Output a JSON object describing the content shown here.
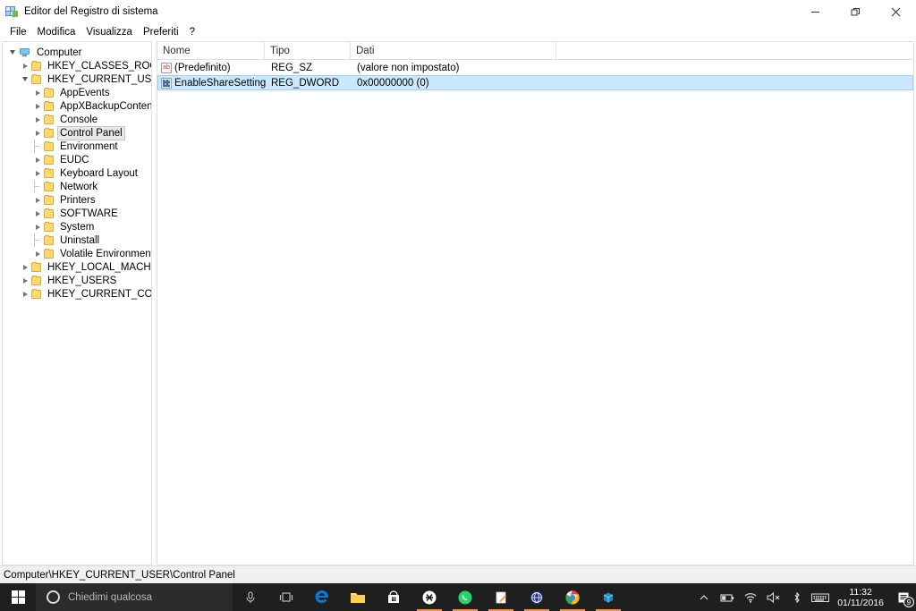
{
  "window": {
    "title": "Editor del Registro di sistema",
    "icon": "registry-editor-icon",
    "controls": {
      "minimize": "minimize-icon",
      "restore": "restore-icon",
      "close": "close-icon"
    }
  },
  "menubar": {
    "items": [
      {
        "label": "File"
      },
      {
        "label": "Modifica"
      },
      {
        "label": "Visualizza"
      },
      {
        "label": "Preferiti"
      },
      {
        "label": "?"
      }
    ]
  },
  "tree": {
    "items": [
      {
        "label": "Computer",
        "depth": 0,
        "state": "open",
        "icon": "computer-icon",
        "selected": false
      },
      {
        "label": "HKEY_CLASSES_ROOT",
        "depth": 1,
        "state": "collapsed",
        "icon": "folder-icon",
        "selected": false
      },
      {
        "label": "HKEY_CURRENT_USER",
        "depth": 1,
        "state": "open",
        "icon": "folder-icon",
        "selected": false
      },
      {
        "label": "AppEvents",
        "depth": 2,
        "state": "collapsed",
        "icon": "folder-icon",
        "selected": false
      },
      {
        "label": "AppXBackupContentType",
        "depth": 2,
        "state": "collapsed",
        "icon": "folder-icon",
        "selected": false
      },
      {
        "label": "Console",
        "depth": 2,
        "state": "collapsed",
        "icon": "folder-icon",
        "selected": false
      },
      {
        "label": "Control Panel",
        "depth": 2,
        "state": "collapsed",
        "icon": "folder-icon",
        "selected": true
      },
      {
        "label": "Environment",
        "depth": 2,
        "state": "leaf",
        "icon": "folder-icon",
        "selected": false
      },
      {
        "label": "EUDC",
        "depth": 2,
        "state": "collapsed",
        "icon": "folder-icon",
        "selected": false
      },
      {
        "label": "Keyboard Layout",
        "depth": 2,
        "state": "collapsed",
        "icon": "folder-icon",
        "selected": false
      },
      {
        "label": "Network",
        "depth": 2,
        "state": "leaf",
        "icon": "folder-icon",
        "selected": false
      },
      {
        "label": "Printers",
        "depth": 2,
        "state": "collapsed",
        "icon": "folder-icon",
        "selected": false
      },
      {
        "label": "SOFTWARE",
        "depth": 2,
        "state": "collapsed",
        "icon": "folder-icon",
        "selected": false
      },
      {
        "label": "System",
        "depth": 2,
        "state": "collapsed",
        "icon": "folder-icon",
        "selected": false
      },
      {
        "label": "Uninstall",
        "depth": 2,
        "state": "leaf",
        "icon": "folder-icon",
        "selected": false
      },
      {
        "label": "Volatile Environment",
        "depth": 2,
        "state": "collapsed",
        "icon": "folder-icon",
        "selected": false
      },
      {
        "label": "HKEY_LOCAL_MACHINE",
        "depth": 1,
        "state": "collapsed",
        "icon": "folder-icon",
        "selected": false
      },
      {
        "label": "HKEY_USERS",
        "depth": 1,
        "state": "collapsed",
        "icon": "folder-icon",
        "selected": false
      },
      {
        "label": "HKEY_CURRENT_CONFIG",
        "depth": 1,
        "state": "collapsed",
        "icon": "folder-icon",
        "selected": false
      }
    ]
  },
  "list": {
    "columns": [
      {
        "label": "Nome"
      },
      {
        "label": "Tipo"
      },
      {
        "label": "Dati"
      }
    ],
    "rows": [
      {
        "name": "(Predefinito)",
        "type": "REG_SZ",
        "data": "(valore non impostato)",
        "icon": "string-value-icon",
        "selected": false
      },
      {
        "name": "EnableShareSettings",
        "type": "REG_DWORD",
        "data": "0x00000000 (0)",
        "icon": "dword-value-icon",
        "selected": true
      }
    ]
  },
  "statusbar": {
    "path": "Computer\\HKEY_CURRENT_USER\\Control Panel"
  },
  "taskbar": {
    "start": "windows-start-icon",
    "search": {
      "placeholder": "Chiedimi qualcosa",
      "icon": "cortana-icon"
    },
    "quick_icons": [
      {
        "name": "microphone-icon",
        "running": false
      },
      {
        "name": "task-view-icon",
        "running": false
      }
    ],
    "apps": [
      {
        "name": "edge-icon",
        "running": false
      },
      {
        "name": "file-explorer-icon",
        "running": false
      },
      {
        "name": "microsoft-store-icon",
        "running": false
      },
      {
        "name": "app-dark-icon",
        "running": true
      },
      {
        "name": "whatsapp-icon",
        "running": true
      },
      {
        "name": "notepad-icon",
        "running": true
      },
      {
        "name": "blue-globe-icon",
        "running": true
      },
      {
        "name": "chrome-icon",
        "running": true
      },
      {
        "name": "registry-editor-icon",
        "running": true
      }
    ],
    "tray": [
      {
        "name": "show-hidden-icons-icon"
      },
      {
        "name": "battery-icon"
      },
      {
        "name": "wifi-icon"
      },
      {
        "name": "volume-muted-icon"
      },
      {
        "name": "bluetooth-icon"
      },
      {
        "name": "touch-keyboard-icon"
      }
    ],
    "clock": {
      "time": "11:32",
      "date": "01/11/2016"
    },
    "action_center": {
      "icon": "action-center-icon",
      "badge": "9"
    }
  },
  "colors": {
    "selection_blue": "#cce8ff",
    "selection_border": "#99d1ff",
    "taskbar": "#1f1f1f",
    "running_indicator": "#f0903c",
    "folder_yellow": "#ffd870"
  }
}
